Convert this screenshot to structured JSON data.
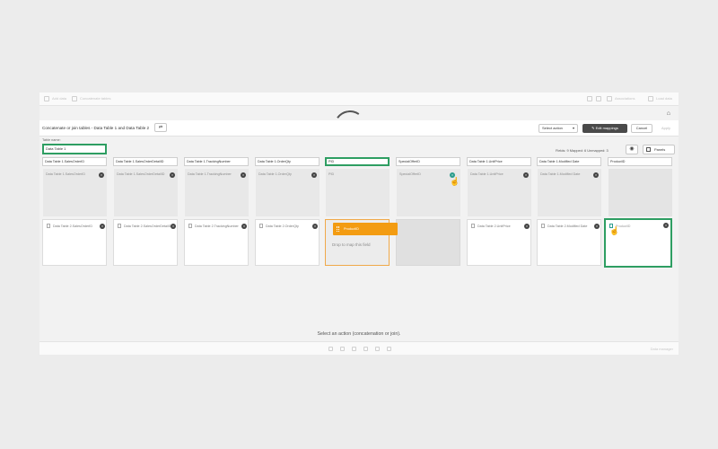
{
  "topbar": {
    "left_items": [
      "Add data",
      "Concatenate tables"
    ],
    "right_items": [
      "Associations",
      "Load data"
    ]
  },
  "header": {
    "title": "Concatenate or join tables - Data Table 1 and Data Table 2",
    "select_action_label": "Select action",
    "edit_mappings_label": "Edit mappings",
    "cancel_label": "Cancel",
    "apply_label": "Apply"
  },
  "table_name": {
    "label": "Table name:",
    "value": "Data Table 1"
  },
  "fields_info": "Fields: 9   Mapped: 6   Unmapped: 3",
  "panels_label": "Panels",
  "columns": [
    {
      "header": "Data Table 1.SalesOrderID",
      "field": "Data Table 1.SalesOrderID",
      "t2": "Data Table 2.SalesOrderID"
    },
    {
      "header": "Data Table 1.SalesOrderDetailID",
      "field": "Data Table 1.SalesOrderDetailID",
      "t2": "Data Table 2.SalesOrderDetailID"
    },
    {
      "header": "Data Table 1.TrackingNumber",
      "field": "Data Table 1.TrackingNumber",
      "t2": "Data Table 2.TrackingNumber"
    },
    {
      "header": "Data Table 1.OrderQty",
      "field": "Data Table 1.OrderQty",
      "t2": "Data Table 2.OrderQty"
    },
    {
      "header": "PID",
      "field": "PID",
      "t2": ""
    },
    {
      "header": "SpecialOfferID",
      "field": "SpecialOfferID",
      "t2": ""
    },
    {
      "header": "Data Table 1.UnitPrice",
      "field": "Data Table 1.UnitPrice",
      "t2": "Data Table 2.UnitPrice"
    },
    {
      "header": "Data Table 1.Modified Date",
      "field": "Data Table 1.Modified Date",
      "t2": "Data Table 2.Modified Date"
    },
    {
      "header": "ProductID",
      "field": "",
      "t2": "ProductID"
    }
  ],
  "drag": {
    "chip_label": "ProductID",
    "drop_hint": "Drop to map this field"
  },
  "status_message": "Select an action (concatenation or join).",
  "bottombar": {
    "right_text": "Data manager"
  },
  "colors": {
    "accent_green": "#2e9e62",
    "drag_orange": "#f39c12",
    "teal": "#2b9c8b"
  },
  "icons": [
    "home-icon",
    "swap-icon",
    "eye-icon",
    "grid-icon",
    "close-icon",
    "hand-cursor-icon",
    "document-icon"
  ]
}
